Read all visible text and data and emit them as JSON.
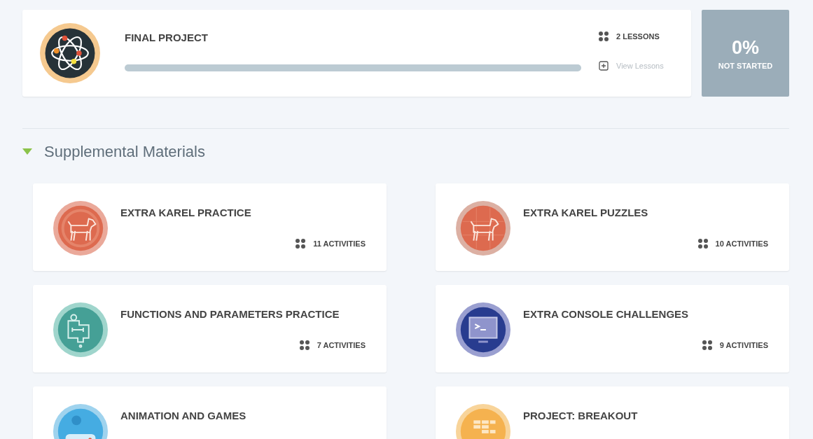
{
  "final_project": {
    "title": "FINAL PROJECT",
    "kind": "atom",
    "level": 0,
    "count": "2 LESSONS",
    "view_link": "View Lessons",
    "percent": "0%",
    "status": "NOT STARTED"
  },
  "section": {
    "title": "Supplemental Materials",
    "expanded": true
  },
  "modules": [
    {
      "title": "EXTRA KAREL PRACTICE",
      "kind": "dog-target",
      "count": "11 ACTIVITIES"
    },
    {
      "title": "EXTRA KAREL PUZZLES",
      "kind": "dog-grid",
      "count": "10 ACTIVITIES"
    },
    {
      "title": "FUNCTIONS AND PARAMETERS PRACTICE",
      "kind": "function",
      "count": "7 ACTIVITIES"
    },
    {
      "title": "EXTRA CONSOLE CHALLENGES",
      "kind": "console",
      "count": "9 ACTIVITIES"
    },
    {
      "title": "ANIMATION AND GAMES",
      "kind": "gamepad"
    },
    {
      "title": "PROJECT: BREAKOUT",
      "kind": "bricks"
    }
  ]
}
